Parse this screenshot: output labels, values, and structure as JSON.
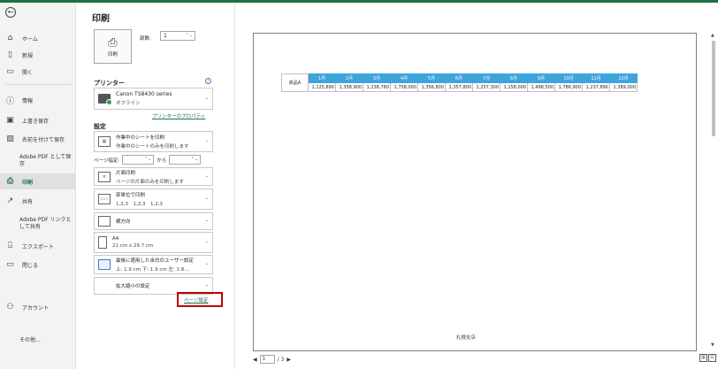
{
  "sidebar": {
    "back_icon": "back-arrow-icon",
    "items": [
      {
        "label": "ホーム",
        "icon": "⌂"
      },
      {
        "label": "新規",
        "icon": "▯"
      },
      {
        "label": "開く",
        "icon": "▭"
      },
      {
        "label": "情報",
        "icon": "ⓘ"
      },
      {
        "label": "上書き保存",
        "icon": "▣"
      },
      {
        "label": "名前を付けて保存",
        "icon": "▨"
      },
      {
        "label": "Adobe PDF として保存"
      },
      {
        "label": "印刷",
        "icon": "⎙"
      },
      {
        "label": "共有",
        "icon": "↗"
      },
      {
        "label": "Adobe PDF リンクとして共有"
      },
      {
        "label": "エクスポート",
        "icon": "⍈"
      },
      {
        "label": "閉じる",
        "icon": "▭"
      },
      {
        "label": "アカウント",
        "icon": "⚇"
      },
      {
        "label": "その他..."
      }
    ]
  },
  "panel": {
    "title": "印刷",
    "print_button": "印刷",
    "copies_label": "部数:",
    "copies_value": "1",
    "printer_heading": "プリンター",
    "printer_name": "Canon TS8430 series",
    "printer_status": "オフライン",
    "printer_props_link": "プリンターのプロパティ",
    "settings_heading": "設定",
    "opt_sheet_1": "作業中のシートを印刷",
    "opt_sheet_2": "作業中のシートのみを印刷します",
    "pages_label": "ページ指定:",
    "pages_to": "から",
    "opt_side_1": "片面印刷",
    "opt_side_2": "ページの片面のみを印刷します",
    "opt_collate_1": "部単位で印刷",
    "opt_collate_2": "1,2,3　1,2,3　1,2,3",
    "opt_orient": "横方向",
    "opt_paper_1": "A4",
    "opt_paper_2": "21 cm x 29.7 cm",
    "opt_margin_1": "最後に適用した余白のユーザー設定",
    "opt_margin_2": "上: 1.9 cm 下: 1.9 cm 左: 1.8…",
    "opt_scale": "拡大縮小の設定",
    "page_setup_link": "ページ設定"
  },
  "preview": {
    "product": "商品A",
    "months": [
      "1月",
      "2月",
      "3月",
      "4月",
      "5月",
      "6月",
      "7月",
      "8月",
      "9月",
      "10月",
      "11月",
      "12月"
    ],
    "values": [
      "1,125,890",
      "1,358,900",
      "1,238,760",
      "1,758,000",
      "1,356,800",
      "1,357,800",
      "1,257,300",
      "1,158,000",
      "1,498,500",
      "1,786,900",
      "1,237,890",
      "1,389,000"
    ],
    "footer": "札幌支店",
    "page_current": "1",
    "page_total": "/ 3"
  }
}
